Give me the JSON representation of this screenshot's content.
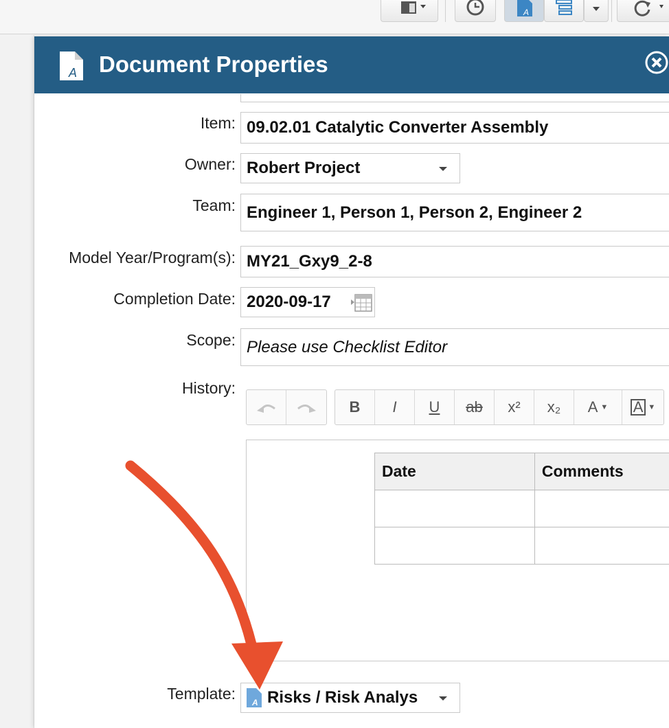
{
  "dialog": {
    "title": "Document Properties",
    "icons": {
      "document": "document-a-icon",
      "close": "close-circle-icon"
    }
  },
  "toolbar": {
    "icons": [
      "layout-icon",
      "history-clock-icon",
      "document-a-icon",
      "tree-list-icon",
      "refresh-icon"
    ]
  },
  "form": {
    "item": {
      "label": "Item:",
      "value": "09.02.01 Catalytic Converter Assembly"
    },
    "owner": {
      "label": "Owner:",
      "value": "Robert Project"
    },
    "team": {
      "label": "Team:",
      "value": "Engineer 1, Person 1, Person 2, Engineer 2"
    },
    "model_year": {
      "label": "Model Year/Program(s):",
      "value": "MY21_Gxy9_2-8"
    },
    "completion_date": {
      "label": "Completion Date:",
      "value": "2020-09-17"
    },
    "scope": {
      "label": "Scope:",
      "value": "Please use Checklist Editor"
    },
    "history": {
      "label": "History:",
      "toolbar": [
        "undo-icon",
        "redo-icon",
        "B",
        "I",
        "U",
        "ab",
        "x²",
        "x₂",
        "A",
        "A"
      ],
      "table": {
        "headers": [
          "Date",
          "Comments"
        ],
        "rows": [
          [
            "",
            ""
          ],
          [
            "",
            ""
          ]
        ]
      }
    },
    "template": {
      "label": "Template:",
      "value": "Risks / Risk Analys"
    }
  },
  "colors": {
    "header": "#245d85",
    "annotation_arrow": "#e8502e"
  }
}
